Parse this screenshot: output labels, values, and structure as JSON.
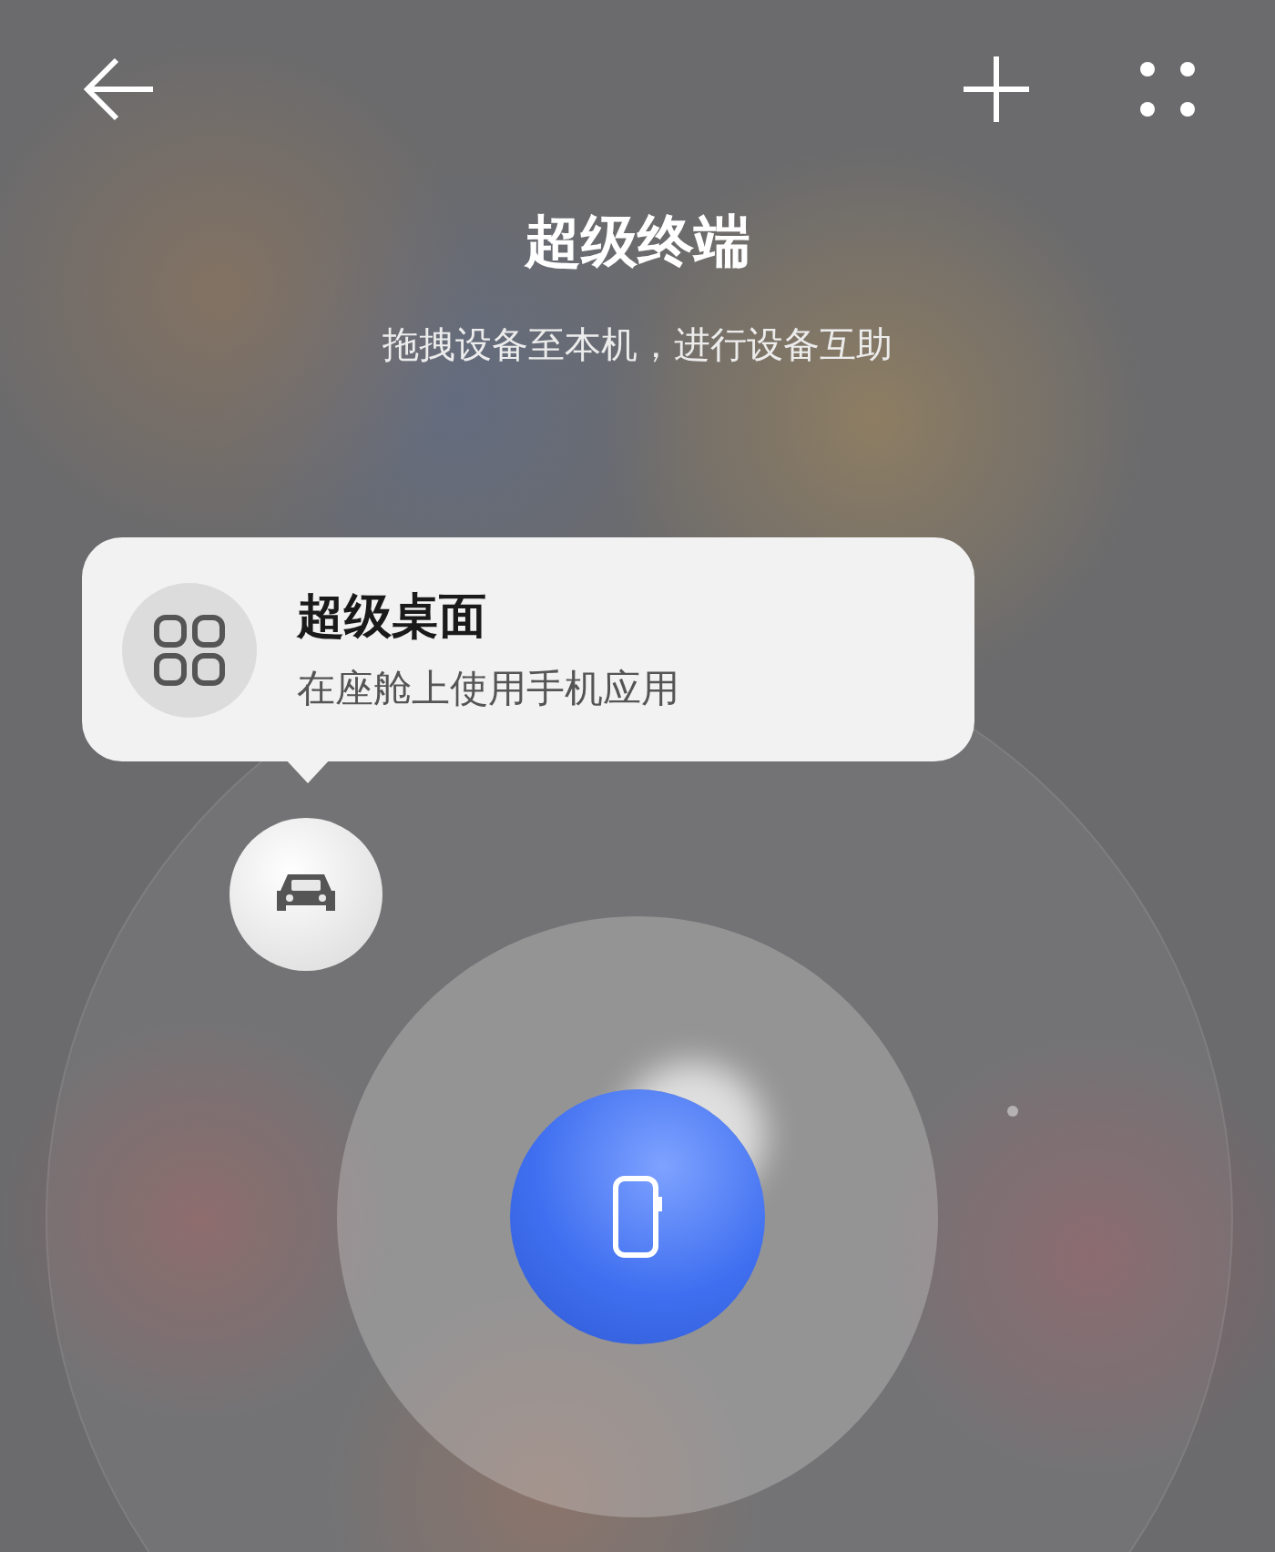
{
  "title": "超级终端",
  "subtitle": "拖拽设备至本机，进行设备互助",
  "popup": {
    "title": "超级桌面",
    "description": "在座舱上使用手机应用"
  }
}
